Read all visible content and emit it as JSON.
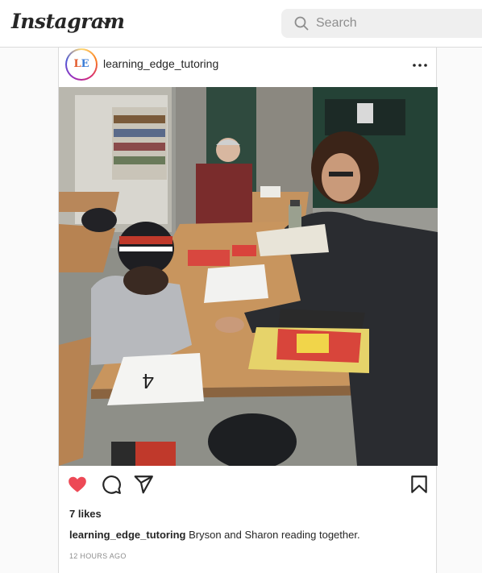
{
  "header": {
    "logo_text": "Instagram",
    "logo_menu_icon": "chevron-down-icon",
    "search": {
      "placeholder": "Search",
      "icon": "search-icon"
    }
  },
  "post": {
    "author": {
      "username": "learning_edge_tutoring",
      "avatar_initials": "LE"
    },
    "more_icon": "more-horizontal-icon",
    "image_alt": "Photo: tutoring session at cafeteria tables",
    "actions": {
      "like": {
        "icon": "heart-icon",
        "state": "liked",
        "color": "#ed4956"
      },
      "comment": {
        "icon": "comment-icon"
      },
      "share": {
        "icon": "paper-plane-icon"
      },
      "save": {
        "icon": "bookmark-icon"
      }
    },
    "likes_text": "7 likes",
    "caption": {
      "username": "learning_edge_tutoring",
      "text": "Bryson and Sharon reading together."
    },
    "timestamp": "12 HOURS AGO"
  },
  "colors": {
    "border": "#dbdbdb",
    "text": "#262626",
    "muted": "#8e8e8e",
    "search_bg": "#efefef",
    "like": "#ed4956"
  }
}
